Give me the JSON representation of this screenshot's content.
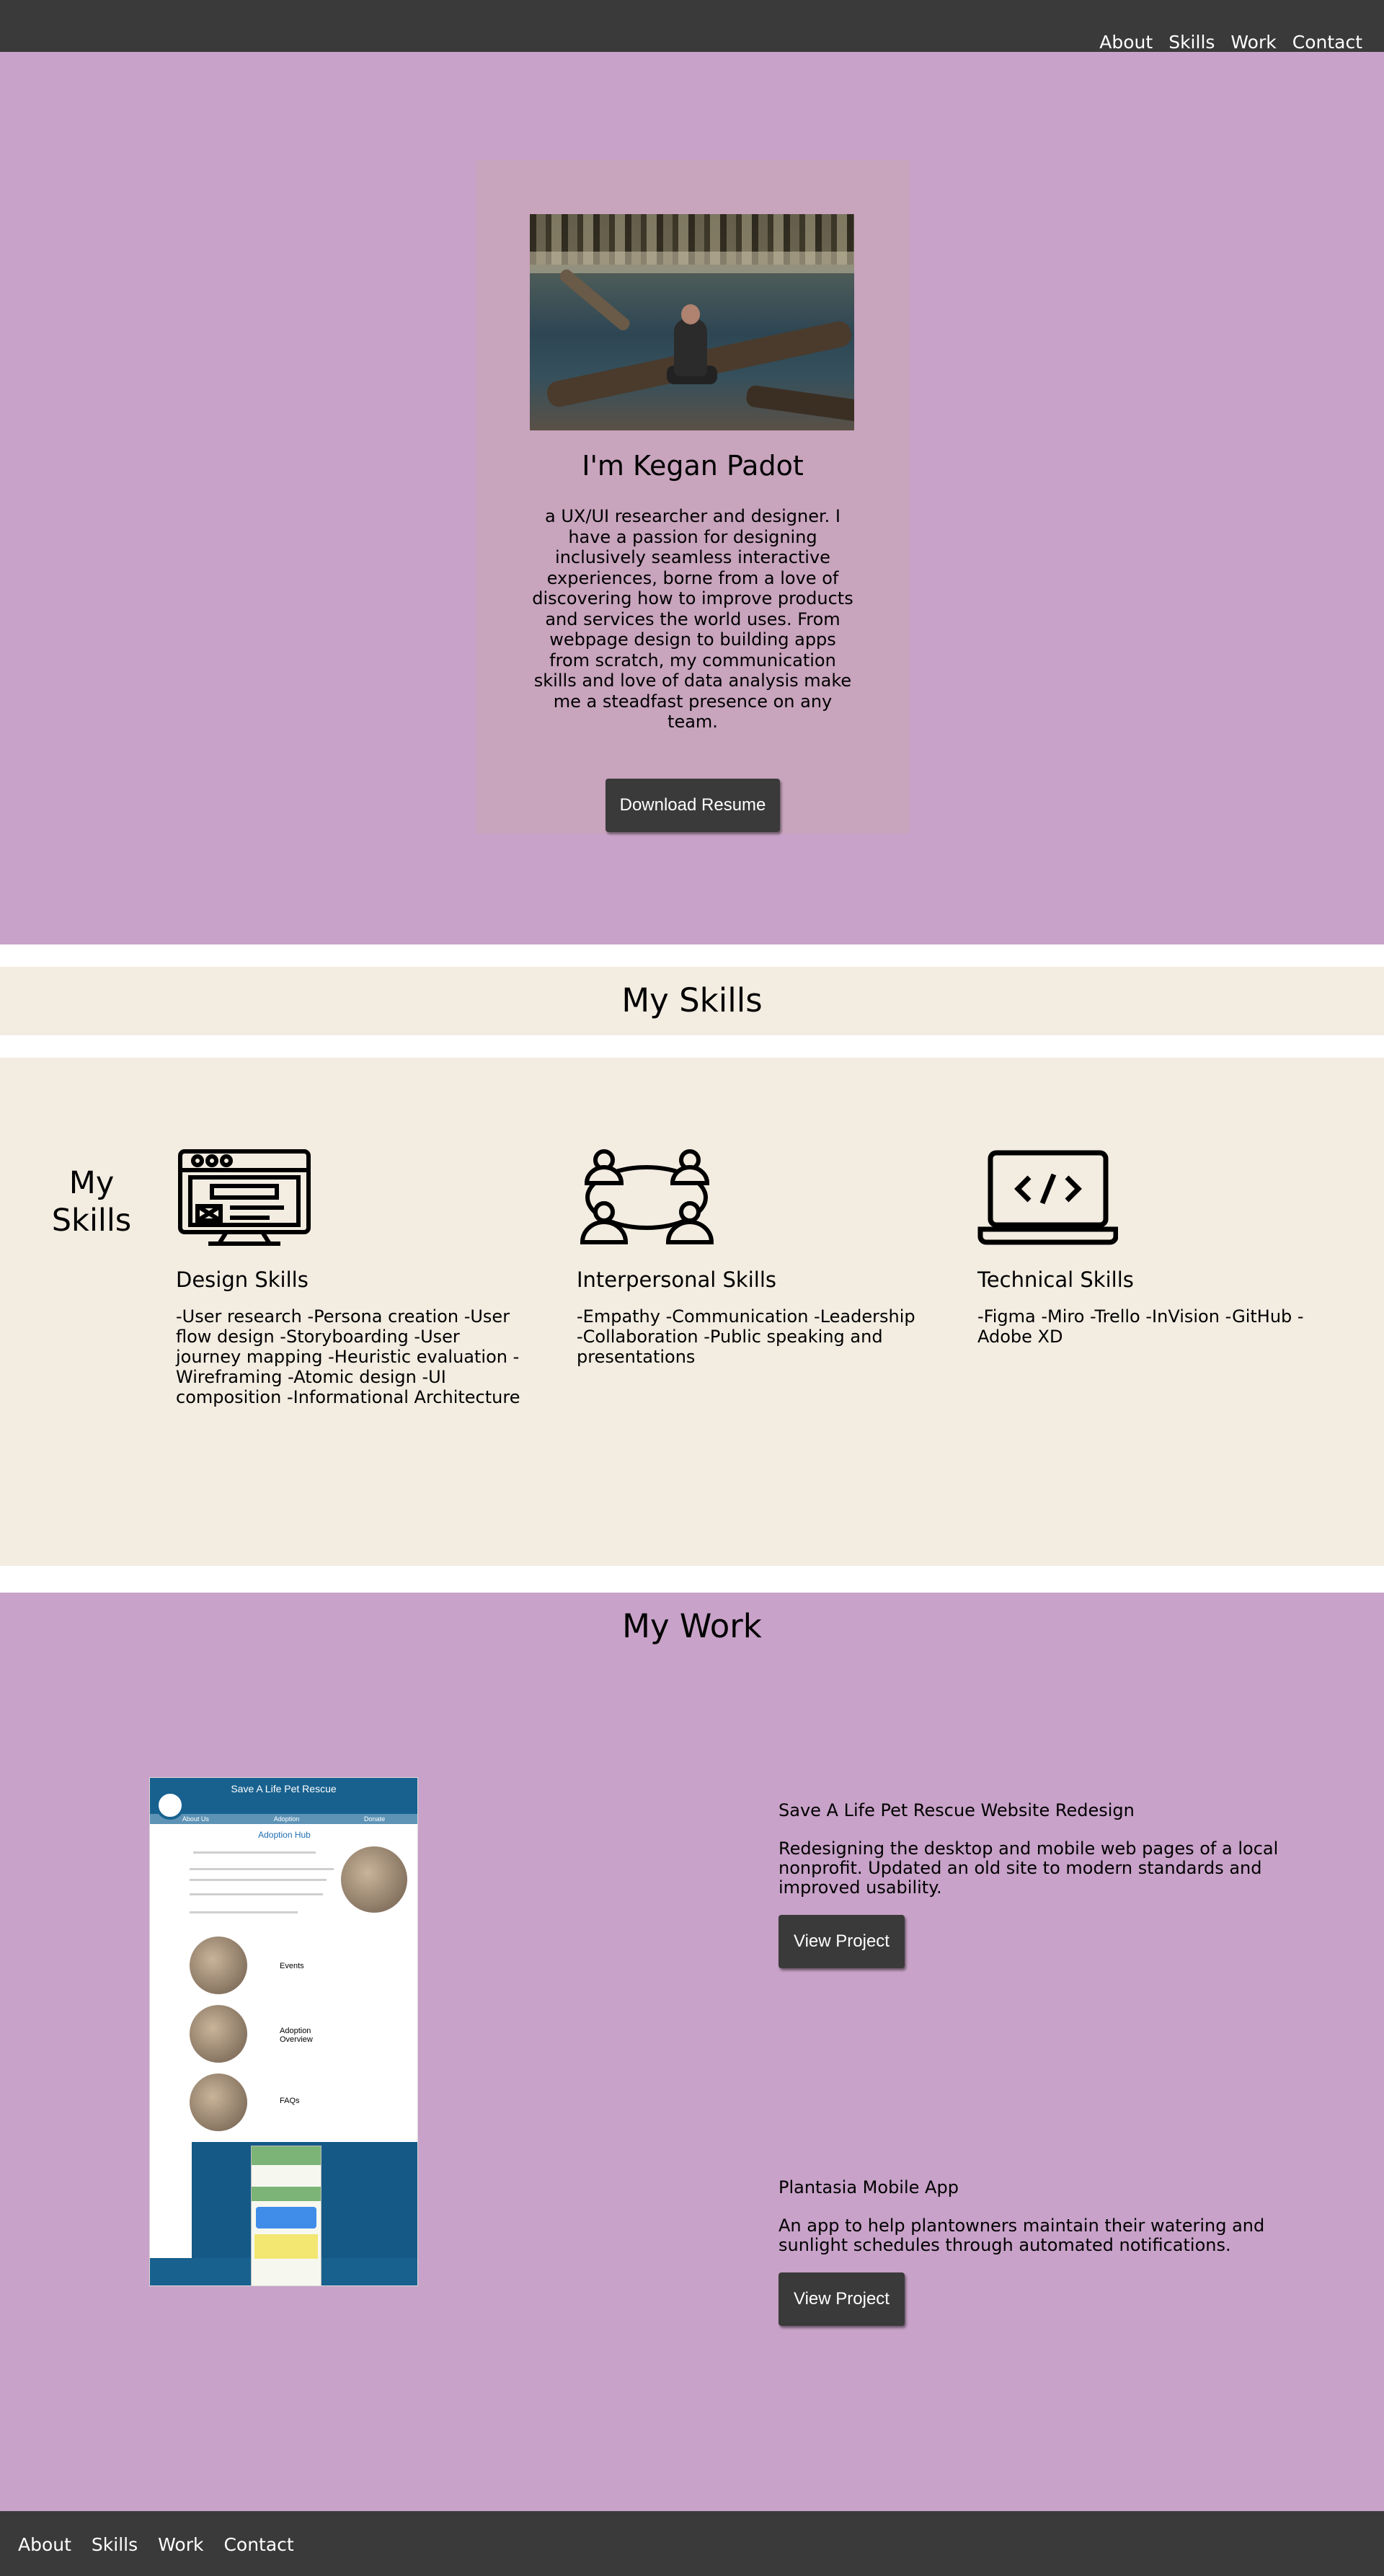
{
  "nav": {
    "links": [
      "About",
      "Skills",
      "Work",
      "Contact"
    ]
  },
  "hero": {
    "title": "I'm Kegan Padot",
    "bio": "a UX/UI researcher and designer. I have a passion for designing inclusively seamless interactive experiences, borne from a love of discovering how to improve products and services the world uses. From webpage design to building apps from scratch, my communication skills and love of data analysis make me a steadfast presence on any team.",
    "button": "Download Resume"
  },
  "skills_banner": {
    "title": "My Skills"
  },
  "skills": {
    "side_title": "My Skills",
    "items": [
      {
        "icon": "design-icon",
        "title": "Design Skills",
        "text": "-User research -Persona creation -User flow design -Storyboarding -User journey mapping -Heuristic evaluation -Wireframing -Atomic design -UI composition -Informational Architecture"
      },
      {
        "icon": "team-icon",
        "title": "Interpersonal Skills",
        "text": "-Empathy -Communication -Leadership -Collaboration -Public speaking and presentations"
      },
      {
        "icon": "laptop-code-icon",
        "title": "Technical Skills",
        "text": "-Figma -Miro -Trello -InVision -GitHub -Adobe XD"
      }
    ]
  },
  "work": {
    "title": "My Work",
    "mockup": {
      "header": "Save A Life Pet Rescue",
      "nav": [
        "About Us",
        "Adoption",
        "Donate"
      ],
      "heading": "Adoption Hub",
      "tiles": [
        "Events",
        "Adoption Overview",
        "FAQs"
      ]
    },
    "projects": [
      {
        "title": "Save A Life Pet Rescue Website Redesign",
        "text": "Redesigning the desktop and mobile web pages of a local nonprofit. Updated an old site to modern standards and improved usability.",
        "button": "View Project"
      },
      {
        "title": "Plantasia Mobile App",
        "text": "An app to help plantowners maintain their watering and sunlight schedules through automated notifications.",
        "button": "View Project"
      }
    ]
  },
  "footer": {
    "links": [
      "About",
      "Skills",
      "Work",
      "Contact"
    ]
  },
  "colors": {
    "nav": "#3a3a3a",
    "hero": "#c8a2c8",
    "card": "#c8a4bd",
    "skills": "#f2ece1",
    "button": "#3a3a3a"
  }
}
